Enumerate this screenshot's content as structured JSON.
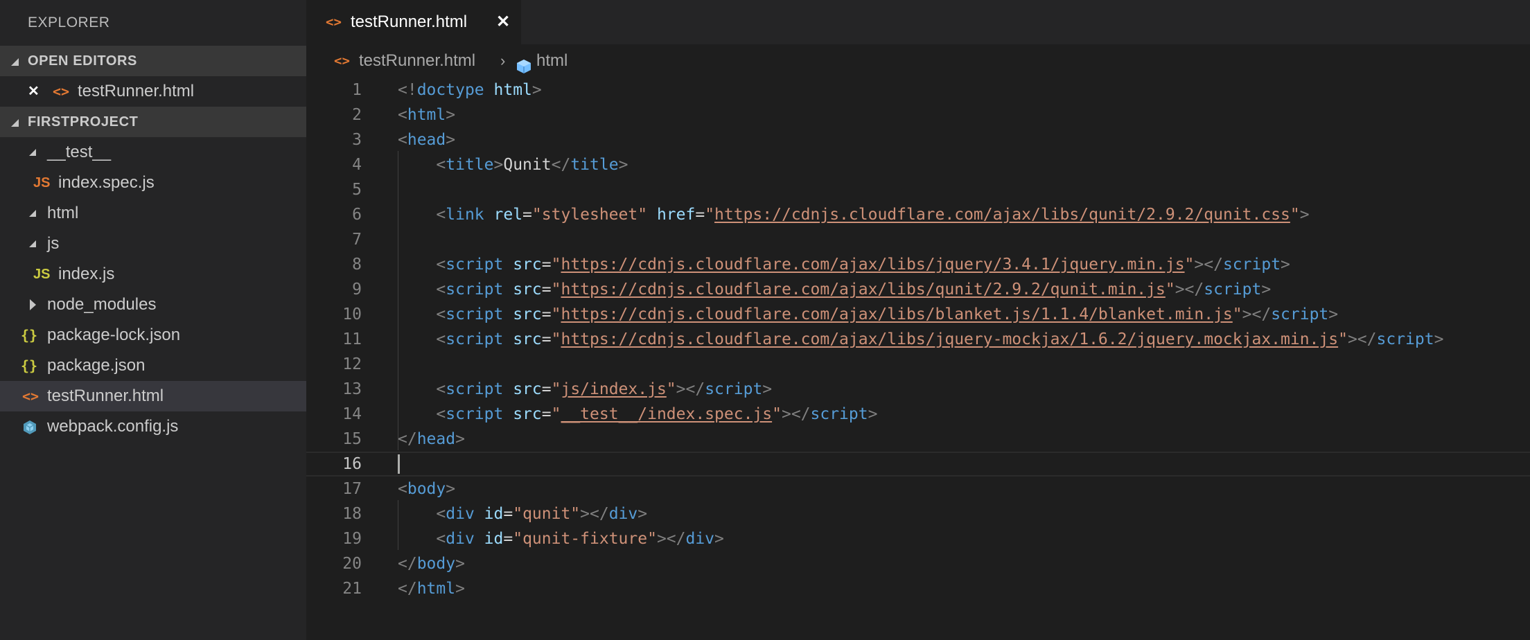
{
  "sidebar": {
    "title": "EXPLORER",
    "open_editors": {
      "label": "OPEN EDITORS",
      "items": [
        {
          "close": "✕",
          "icon": "<>",
          "label": "testRunner.html"
        }
      ]
    },
    "project": {
      "label": "FIRSTPROJECT",
      "items": [
        {
          "label": "__test__"
        },
        {
          "icon": "JS",
          "label": "index.spec.js"
        },
        {
          "label": "html"
        },
        {
          "label": "js"
        },
        {
          "icon": "JS",
          "label": "index.js"
        },
        {
          "label": "node_modules"
        },
        {
          "icon": "{}",
          "label": "package-lock.json"
        },
        {
          "icon": "{}",
          "label": "package.json"
        },
        {
          "icon": "<>",
          "label": "testRunner.html"
        },
        {
          "label": "webpack.config.js"
        }
      ]
    }
  },
  "tab": {
    "icon": "<>",
    "label": "testRunner.html",
    "close": "✕"
  },
  "breadcrumb": {
    "file_icon": "<>",
    "file": "testRunner.html",
    "sep": "›",
    "node": "html"
  },
  "editor": {
    "current_line": 16,
    "lines": [
      {
        "n": "1",
        "tokens": [
          [
            "p",
            "<!"
          ],
          [
            "tag",
            "doctype"
          ],
          [
            "p",
            " "
          ],
          [
            "attr",
            "html"
          ],
          [
            "p",
            ">"
          ]
        ]
      },
      {
        "n": "2",
        "tokens": [
          [
            "p",
            "<"
          ],
          [
            "tag",
            "html"
          ],
          [
            "p",
            ">"
          ]
        ]
      },
      {
        "n": "3",
        "tokens": [
          [
            "p",
            "<"
          ],
          [
            "tag",
            "head"
          ],
          [
            "p",
            ">"
          ]
        ]
      },
      {
        "n": "4",
        "tokens": [
          [
            "p",
            "    <"
          ],
          [
            "tag",
            "title"
          ],
          [
            "p",
            ">"
          ],
          [
            "txt",
            "Qunit"
          ],
          [
            "p",
            "</"
          ],
          [
            "tag",
            "title"
          ],
          [
            "p",
            ">"
          ]
        ]
      },
      {
        "n": "5",
        "tokens": []
      },
      {
        "n": "6",
        "tokens": [
          [
            "p",
            "    <"
          ],
          [
            "tag",
            "link"
          ],
          [
            "p",
            " "
          ],
          [
            "attr",
            "rel"
          ],
          [
            "txt",
            "="
          ],
          [
            "str",
            "\"stylesheet\""
          ],
          [
            "p",
            " "
          ],
          [
            "attr",
            "href"
          ],
          [
            "txt",
            "="
          ],
          [
            "str",
            "\""
          ],
          [
            "url",
            "https://cdnjs.cloudflare.com/ajax/libs/qunit/2.9.2/qunit.css"
          ],
          [
            "str",
            "\""
          ],
          [
            "p",
            ">"
          ]
        ]
      },
      {
        "n": "7",
        "tokens": []
      },
      {
        "n": "8",
        "tokens": [
          [
            "p",
            "    <"
          ],
          [
            "tag",
            "script"
          ],
          [
            "p",
            " "
          ],
          [
            "attr",
            "src"
          ],
          [
            "txt",
            "="
          ],
          [
            "str",
            "\""
          ],
          [
            "url",
            "https://cdnjs.cloudflare.com/ajax/libs/jquery/3.4.1/jquery.min.js"
          ],
          [
            "str",
            "\""
          ],
          [
            "p",
            "></"
          ],
          [
            "tag",
            "script"
          ],
          [
            "p",
            ">"
          ]
        ]
      },
      {
        "n": "9",
        "tokens": [
          [
            "p",
            "    <"
          ],
          [
            "tag",
            "script"
          ],
          [
            "p",
            " "
          ],
          [
            "attr",
            "src"
          ],
          [
            "txt",
            "="
          ],
          [
            "str",
            "\""
          ],
          [
            "url",
            "https://cdnjs.cloudflare.com/ajax/libs/qunit/2.9.2/qunit.min.js"
          ],
          [
            "str",
            "\""
          ],
          [
            "p",
            "></"
          ],
          [
            "tag",
            "script"
          ],
          [
            "p",
            ">"
          ]
        ]
      },
      {
        "n": "10",
        "tokens": [
          [
            "p",
            "    <"
          ],
          [
            "tag",
            "script"
          ],
          [
            "p",
            " "
          ],
          [
            "attr",
            "src"
          ],
          [
            "txt",
            "="
          ],
          [
            "str",
            "\""
          ],
          [
            "url",
            "https://cdnjs.cloudflare.com/ajax/libs/blanket.js/1.1.4/blanket.min.js"
          ],
          [
            "str",
            "\""
          ],
          [
            "p",
            "></"
          ],
          [
            "tag",
            "script"
          ],
          [
            "p",
            ">"
          ]
        ]
      },
      {
        "n": "11",
        "tokens": [
          [
            "p",
            "    <"
          ],
          [
            "tag",
            "script"
          ],
          [
            "p",
            " "
          ],
          [
            "attr",
            "src"
          ],
          [
            "txt",
            "="
          ],
          [
            "str",
            "\""
          ],
          [
            "url",
            "https://cdnjs.cloudflare.com/ajax/libs/jquery-mockjax/1.6.2/jquery.mockjax.min.js"
          ],
          [
            "str",
            "\""
          ],
          [
            "p",
            "></"
          ],
          [
            "tag",
            "script"
          ],
          [
            "p",
            ">"
          ]
        ]
      },
      {
        "n": "12",
        "tokens": []
      },
      {
        "n": "13",
        "tokens": [
          [
            "p",
            "    <"
          ],
          [
            "tag",
            "script"
          ],
          [
            "p",
            " "
          ],
          [
            "attr",
            "src"
          ],
          [
            "txt",
            "="
          ],
          [
            "str",
            "\""
          ],
          [
            "url",
            "js/index.js"
          ],
          [
            "str",
            "\""
          ],
          [
            "p",
            "></"
          ],
          [
            "tag",
            "script"
          ],
          [
            "p",
            ">"
          ]
        ]
      },
      {
        "n": "14",
        "tokens": [
          [
            "p",
            "    <"
          ],
          [
            "tag",
            "script"
          ],
          [
            "p",
            " "
          ],
          [
            "attr",
            "src"
          ],
          [
            "txt",
            "="
          ],
          [
            "str",
            "\""
          ],
          [
            "url",
            "__test__/index.spec.js"
          ],
          [
            "str",
            "\""
          ],
          [
            "p",
            "></"
          ],
          [
            "tag",
            "script"
          ],
          [
            "p",
            ">"
          ]
        ]
      },
      {
        "n": "15",
        "tokens": [
          [
            "p",
            "</"
          ],
          [
            "tag",
            "head"
          ],
          [
            "p",
            ">"
          ]
        ]
      },
      {
        "n": "16",
        "tokens": []
      },
      {
        "n": "17",
        "tokens": [
          [
            "p",
            "<"
          ],
          [
            "tag",
            "body"
          ],
          [
            "p",
            ">"
          ]
        ]
      },
      {
        "n": "18",
        "tokens": [
          [
            "p",
            "    <"
          ],
          [
            "tag",
            "div"
          ],
          [
            "p",
            " "
          ],
          [
            "attr",
            "id"
          ],
          [
            "txt",
            "="
          ],
          [
            "str",
            "\"qunit\""
          ],
          [
            "p",
            "></"
          ],
          [
            "tag",
            "div"
          ],
          [
            "p",
            ">"
          ]
        ]
      },
      {
        "n": "19",
        "tokens": [
          [
            "p",
            "    <"
          ],
          [
            "tag",
            "div"
          ],
          [
            "p",
            " "
          ],
          [
            "attr",
            "id"
          ],
          [
            "txt",
            "="
          ],
          [
            "str",
            "\"qunit-fixture\""
          ],
          [
            "p",
            "></"
          ],
          [
            "tag",
            "div"
          ],
          [
            "p",
            ">"
          ]
        ]
      },
      {
        "n": "20",
        "tokens": [
          [
            "p",
            "</"
          ],
          [
            "tag",
            "body"
          ],
          [
            "p",
            ">"
          ]
        ]
      },
      {
        "n": "21",
        "tokens": [
          [
            "p",
            "</"
          ],
          [
            "tag",
            "html"
          ],
          [
            "p",
            ">"
          ]
        ]
      }
    ]
  }
}
